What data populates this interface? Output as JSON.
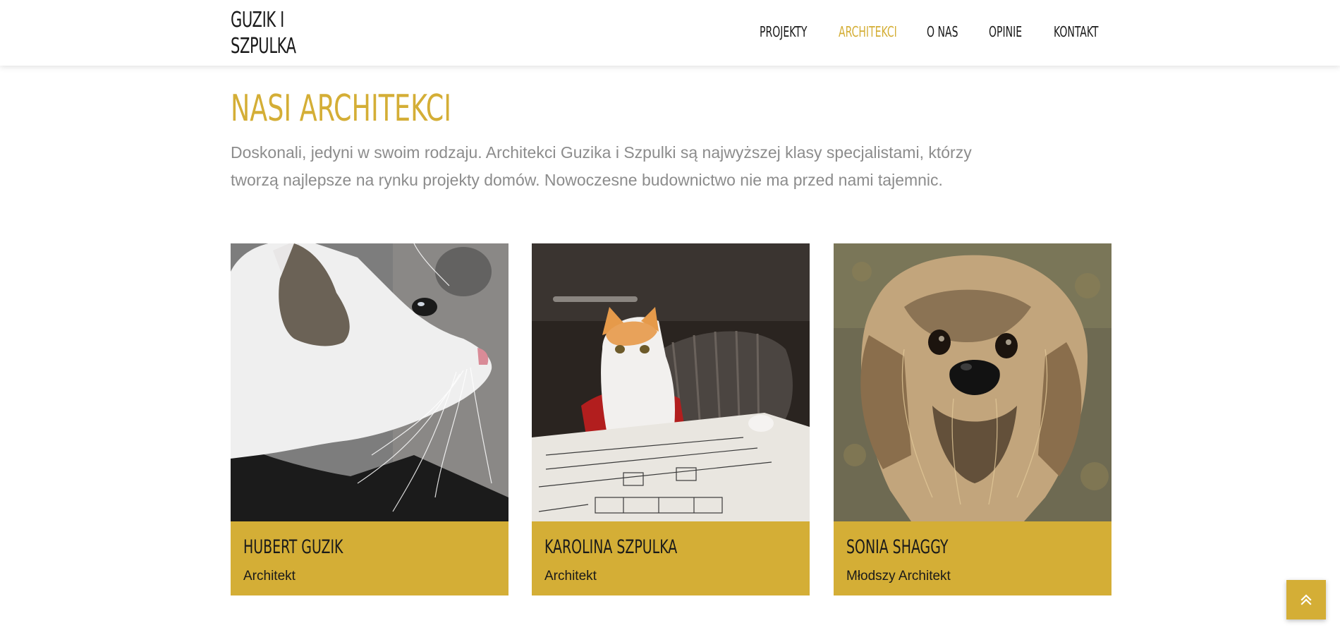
{
  "brand": {
    "line1": "GUZIK I",
    "line2": "SZPULKA"
  },
  "nav": {
    "items": [
      {
        "label": "PROJEKTY"
      },
      {
        "label": "ARCHITEKCI",
        "active": true
      },
      {
        "label": "O NAS"
      },
      {
        "label": "OPINIE"
      },
      {
        "label": "KONTAKT"
      }
    ]
  },
  "main": {
    "title": "NASI ARCHITEKCI",
    "intro_line1": "Doskonali, jedyni w swoim rodzaju. Architekci Guzika i Szpulki są najwyższej klasy specjalistami, którzy",
    "intro_line2": "tworzą najlepsze na rynku projekty domów. Nowoczesne budownictwo nie ma przed nami tajemnic."
  },
  "team": [
    {
      "name": "HUBERT GUZIK",
      "role": "Architekt",
      "photo": "white-grey-cat-profile-photo"
    },
    {
      "name": "KAROLINA SZPULKA",
      "role": "Architekt",
      "photo": "ginger-cat-with-blueprint-photo"
    },
    {
      "name": "SONIA SHAGGY",
      "role": "Młodszy Architekt",
      "photo": "shaggy-terrier-dog-photo"
    }
  ],
  "colors": {
    "accent": "#d4ae36",
    "text": "#1a1a1a",
    "muted": "#8c8c8c"
  },
  "scroll_top_icon": "double-chevron-up-icon"
}
